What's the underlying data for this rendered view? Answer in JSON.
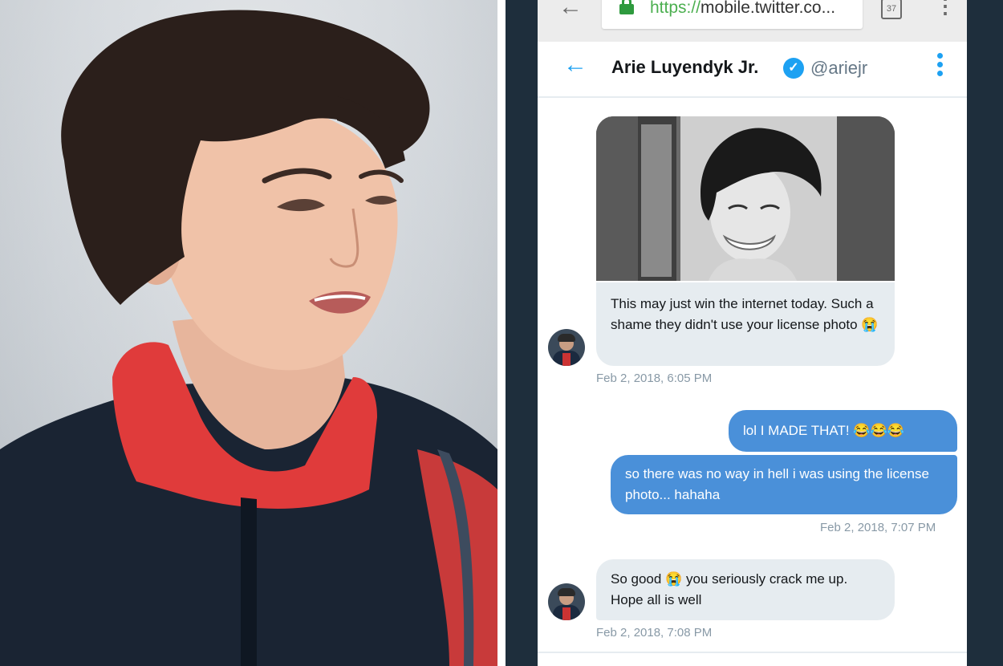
{
  "browser": {
    "url_scheme": "https://",
    "url_rest": "mobile.twitter.co...",
    "tab_count": "37",
    "back_glyph": "←",
    "menu_glyph": "⋮"
  },
  "dm_header": {
    "back_glyph": "←",
    "name": "Arie Luyendyk Jr.",
    "verified_glyph": "✓",
    "handle": "@ariejr"
  },
  "messages": [
    {
      "direction": "in",
      "text": "This may just win the internet today. Such a shame they didn't use your license photo 😭",
      "timestamp": "Feb 2, 2018, 6:05 PM",
      "has_image": true
    },
    {
      "direction": "out",
      "text": "lol I MADE THAT! 😂😂😂"
    },
    {
      "direction": "out",
      "text": "so there was no way in hell i was using the license photo... hahaha",
      "timestamp": "Feb 2, 2018, 7:07 PM"
    },
    {
      "direction": "in",
      "text": "So good 😭 you seriously crack me up. Hope all is well",
      "timestamp": "Feb 2, 2018, 7:08 PM"
    }
  ],
  "colors": {
    "twitter_blue": "#1da1f2",
    "outgoing_bubble": "#4a90d9",
    "incoming_bubble": "#e6ecf0",
    "frame_navy": "#1e2e3c"
  }
}
